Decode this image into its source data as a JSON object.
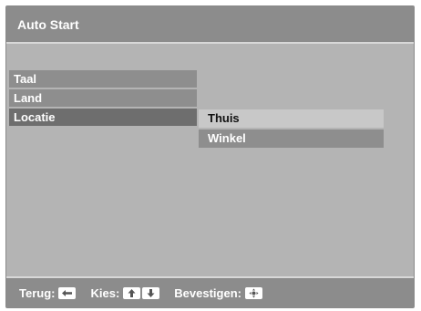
{
  "header": {
    "title": "Auto Start"
  },
  "main_menu": {
    "items": [
      {
        "label": "Taal",
        "selected": false
      },
      {
        "label": "Land",
        "selected": false
      },
      {
        "label": "Locatie",
        "selected": true
      }
    ]
  },
  "submenu": {
    "items": [
      {
        "label": "Thuis",
        "selected": true
      },
      {
        "label": "Winkel",
        "selected": false
      }
    ]
  },
  "footer": {
    "back_label": "Terug:",
    "back_icon": "arrow-left-key-icon",
    "select_label": "Kies:",
    "select_icons": [
      "arrow-up-key-icon",
      "arrow-down-key-icon"
    ],
    "confirm_label": "Bevestigen:",
    "confirm_icon": "dpad-ok-key-icon"
  },
  "colors": {
    "background": "#b4b4b4",
    "bar": "#8c8c8c",
    "menu_item": "#8e8e8e",
    "menu_selected": "#6e6e6e",
    "submenu_selected": "#c8c8c8",
    "text": "#ffffff"
  }
}
